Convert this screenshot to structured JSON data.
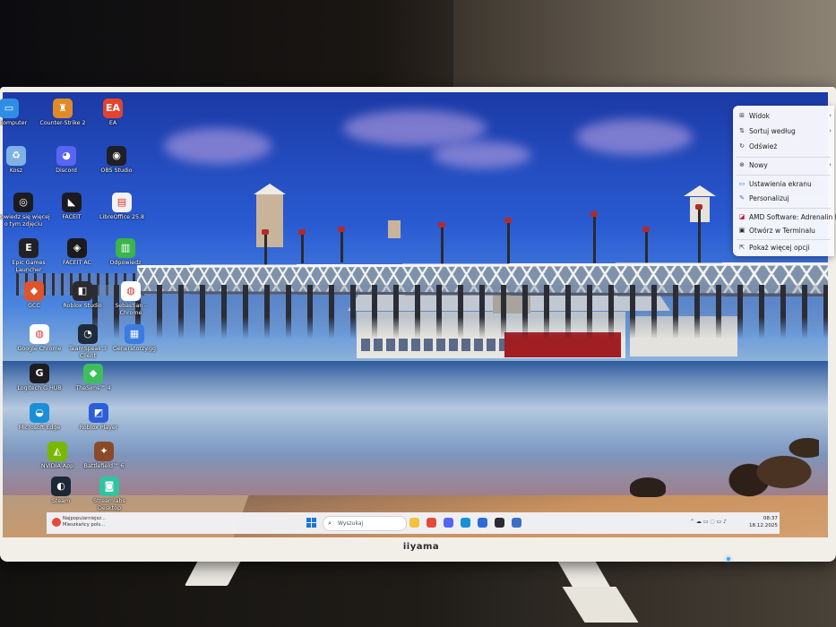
{
  "monitor": {
    "brand": "iiyama"
  },
  "desktop_icons": [
    {
      "label": "en komputer",
      "icon": "computer-icon",
      "color": "#2f8de4",
      "glyph": "▭"
    },
    {
      "label": "Counter-Strike 2",
      "icon": "counter-strike-icon",
      "color": "#e08a2a",
      "glyph": "♜"
    },
    {
      "label": "EA",
      "icon": "ea-icon",
      "color": "#e2442f",
      "glyph": "EA"
    },
    {
      "label": "Kosz",
      "icon": "recycle-bin-icon",
      "color": "#7fb2e6",
      "glyph": "♻"
    },
    {
      "label": "Discord",
      "icon": "discord-icon",
      "color": "#5865f2",
      "glyph": "◕"
    },
    {
      "label": "OBS Studio",
      "icon": "obs-icon",
      "color": "#1f1f24",
      "glyph": "◉"
    },
    {
      "label": "Dowiedz się więcej o tym zdjęciu",
      "icon": "camera-info-icon",
      "color": "#1c1c20",
      "glyph": "◎"
    },
    {
      "label": "FACEIT",
      "icon": "faceit-icon",
      "color": "#1b1b1f",
      "glyph": "◣"
    },
    {
      "label": "LibreOffice 25.8",
      "icon": "libreoffice-icon",
      "color": "#f2f2f2",
      "glyph": "▤"
    },
    {
      "label": "Epic Games Launcher",
      "icon": "epic-games-icon",
      "color": "#222226",
      "glyph": "E"
    },
    {
      "label": "FACEIT AC",
      "icon": "faceit-ac-icon",
      "color": "#1b1b1f",
      "glyph": "◈"
    },
    {
      "label": "Odpowiedz",
      "icon": "odpowiedz-icon",
      "color": "#3ab54a",
      "glyph": "▥"
    },
    {
      "label": "GCC",
      "icon": "gcc-icon",
      "color": "#e0542b",
      "glyph": "◆"
    },
    {
      "label": "Roblox Studio",
      "icon": "roblox-studio-icon",
      "color": "#2a2a30",
      "glyph": "◧"
    },
    {
      "label": "Sebastian - Chrome",
      "icon": "chrome-icon",
      "color": "#ffffff",
      "glyph": "◍"
    },
    {
      "label": "Google Chrome",
      "icon": "chrome-icon",
      "color": "#ffffff",
      "glyph": "◍"
    },
    {
      "label": "TeamSpeak 3 Client",
      "icon": "teamspeak-icon",
      "color": "#1f2a3a",
      "glyph": "◔"
    },
    {
      "label": "Generatorzy.gg",
      "icon": "document-icon",
      "color": "#3c7be0",
      "glyph": "▦"
    },
    {
      "label": "Logitech G HUB",
      "icon": "logitech-icon",
      "color": "#1d1d20",
      "glyph": "G"
    },
    {
      "label": "TheSims™ 4",
      "icon": "sims-icon",
      "color": "#3dbf5c",
      "glyph": "◆"
    },
    {
      "label": "Microsoft Edge",
      "icon": "edge-icon",
      "color": "#1a8fd8",
      "glyph": "◒"
    },
    {
      "label": "Roblox Player",
      "icon": "roblox-player-icon",
      "color": "#2b5fd9",
      "glyph": "◩"
    },
    {
      "label": "NVIDIA App",
      "icon": "nvidia-icon",
      "color": "#76b900",
      "glyph": "◭"
    },
    {
      "label": "Battlefield™ 6",
      "icon": "battlefield-icon",
      "color": "#8a4a2a",
      "glyph": "✦"
    },
    {
      "label": "Steam",
      "icon": "steam-icon",
      "color": "#1b2838",
      "glyph": "◐"
    },
    {
      "label": "Streamlabs Desktop",
      "icon": "streamlabs-icon",
      "color": "#31c3a2",
      "glyph": "◙"
    }
  ],
  "context_menu": {
    "items": [
      {
        "label": "Widok",
        "icon": "grid-icon",
        "glyph": "⊞",
        "has_submenu": true
      },
      {
        "label": "Sortuj według",
        "icon": "sort-icon",
        "glyph": "⇅",
        "has_submenu": true
      },
      {
        "label": "Odśwież",
        "icon": "refresh-icon",
        "glyph": "↻",
        "has_submenu": false
      },
      {
        "label": "Nowy",
        "icon": "new-icon",
        "glyph": "⊕",
        "has_submenu": true
      },
      {
        "label": "Ustawienia ekranu",
        "icon": "display-settings-icon",
        "glyph": "▭",
        "has_submenu": false
      },
      {
        "label": "Personalizuj",
        "icon": "brush-icon",
        "glyph": "✎",
        "has_submenu": false
      },
      {
        "label": "AMD Software: Adrenalin Edition",
        "icon": "amd-icon",
        "glyph": "◪",
        "has_submenu": false
      },
      {
        "label": "Otwórz w Terminalu",
        "icon": "terminal-icon",
        "glyph": "▣",
        "has_submenu": false
      },
      {
        "label": "Pokaż więcej opcji",
        "icon": "more-options-icon",
        "glyph": "⇱",
        "has_submenu": false
      }
    ],
    "submenu_glyph": "›"
  },
  "taskbar": {
    "news_line1": "Najpopularniejsz...",
    "news_line2": "Mieszkańcy pols...",
    "search_placeholder": "Wyszukaj",
    "search_glyph": "⌕",
    "apps": [
      {
        "name": "file-explorer",
        "color": "#f3c13a"
      },
      {
        "name": "chrome",
        "color": "#e24b3b"
      },
      {
        "name": "discord",
        "color": "#5865f2"
      },
      {
        "name": "edge",
        "color": "#1a8fd8"
      },
      {
        "name": "store",
        "color": "#2c6ad8"
      },
      {
        "name": "obs",
        "color": "#2a2a30"
      },
      {
        "name": "teamspeak",
        "color": "#3a6fc4"
      }
    ],
    "tray": "⌃  ☁  ▭  ◌  ▭  ♪",
    "time": "08:37",
    "date": "18.12.2025"
  }
}
